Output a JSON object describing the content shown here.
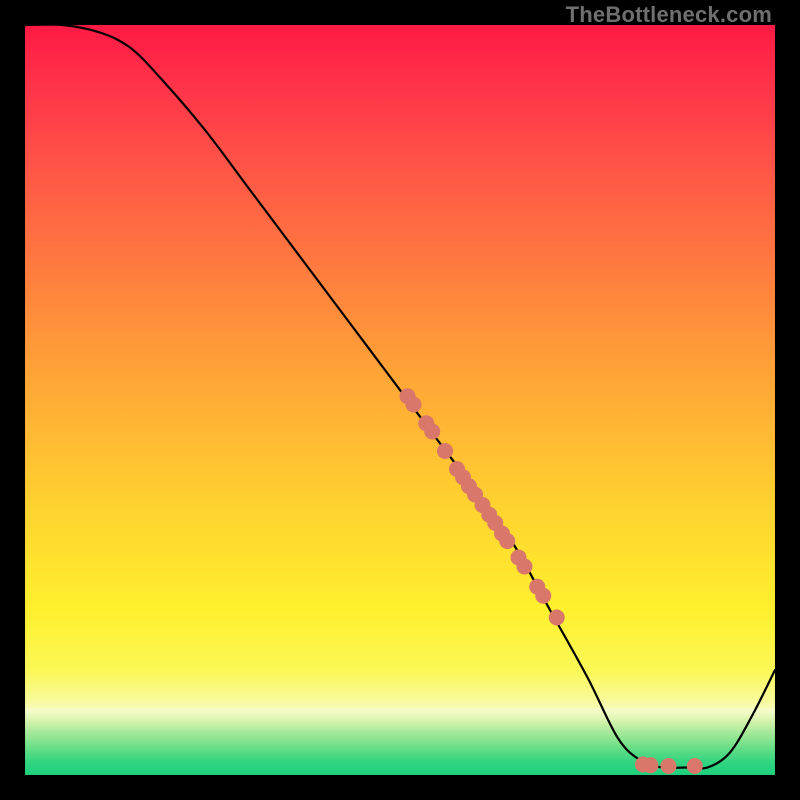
{
  "watermark": "TheBottleneck.com",
  "chart_data": {
    "type": "line",
    "title": "",
    "xlabel": "",
    "ylabel": "",
    "xlim": [
      0,
      100
    ],
    "ylim": [
      0,
      100
    ],
    "grid": false,
    "series": [
      {
        "name": "curve",
        "x": [
          0,
          5,
          10,
          14,
          18,
          24,
          30,
          36,
          42,
          48,
          54,
          60,
          65,
          70,
          75,
          79,
          82,
          85,
          88,
          91,
          94,
          97,
          100
        ],
        "y": [
          100,
          100,
          99,
          97,
          93,
          86,
          78,
          70,
          62,
          54,
          46,
          38,
          31,
          22,
          13,
          5,
          2,
          1,
          1,
          1,
          3,
          8,
          14
        ]
      }
    ],
    "scatter": {
      "name": "marks",
      "color": "#d9776b",
      "radius_px": 8,
      "points": [
        {
          "x": 51.0,
          "y": 50.5
        },
        {
          "x": 51.8,
          "y": 49.4
        },
        {
          "x": 53.5,
          "y": 46.9
        },
        {
          "x": 54.3,
          "y": 45.8
        },
        {
          "x": 56.0,
          "y": 43.2
        },
        {
          "x": 57.6,
          "y": 40.8
        },
        {
          "x": 58.4,
          "y": 39.7
        },
        {
          "x": 59.2,
          "y": 38.5
        },
        {
          "x": 60.0,
          "y": 37.4
        },
        {
          "x": 61.0,
          "y": 36.0
        },
        {
          "x": 61.9,
          "y": 34.7
        },
        {
          "x": 62.7,
          "y": 33.6
        },
        {
          "x": 63.6,
          "y": 32.2
        },
        {
          "x": 64.3,
          "y": 31.2
        },
        {
          "x": 65.8,
          "y": 29.0
        },
        {
          "x": 66.6,
          "y": 27.8
        },
        {
          "x": 68.3,
          "y": 25.1
        },
        {
          "x": 69.1,
          "y": 23.9
        },
        {
          "x": 70.9,
          "y": 21.0
        },
        {
          "x": 82.4,
          "y": 1.4
        },
        {
          "x": 83.4,
          "y": 1.3
        },
        {
          "x": 85.8,
          "y": 1.2
        },
        {
          "x": 89.3,
          "y": 1.2
        }
      ]
    }
  }
}
